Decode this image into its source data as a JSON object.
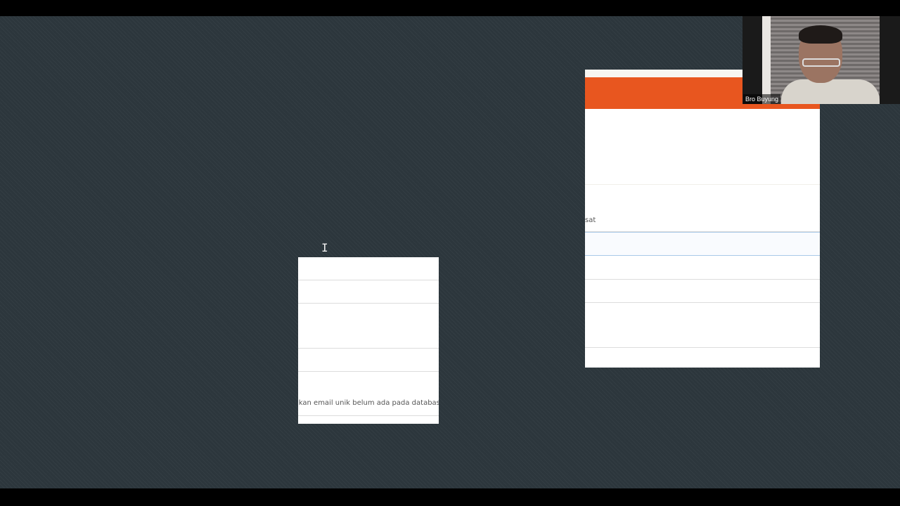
{
  "left_panel": {
    "hint_text": "ikan email unik belum ada pada database."
  },
  "right_panel": {
    "label_fragment": "sat",
    "accent_color": "#e8561f"
  },
  "webcam": {
    "participant_name": "Bro Buyung"
  },
  "cursor": {
    "type": "text-cursor-icon"
  }
}
